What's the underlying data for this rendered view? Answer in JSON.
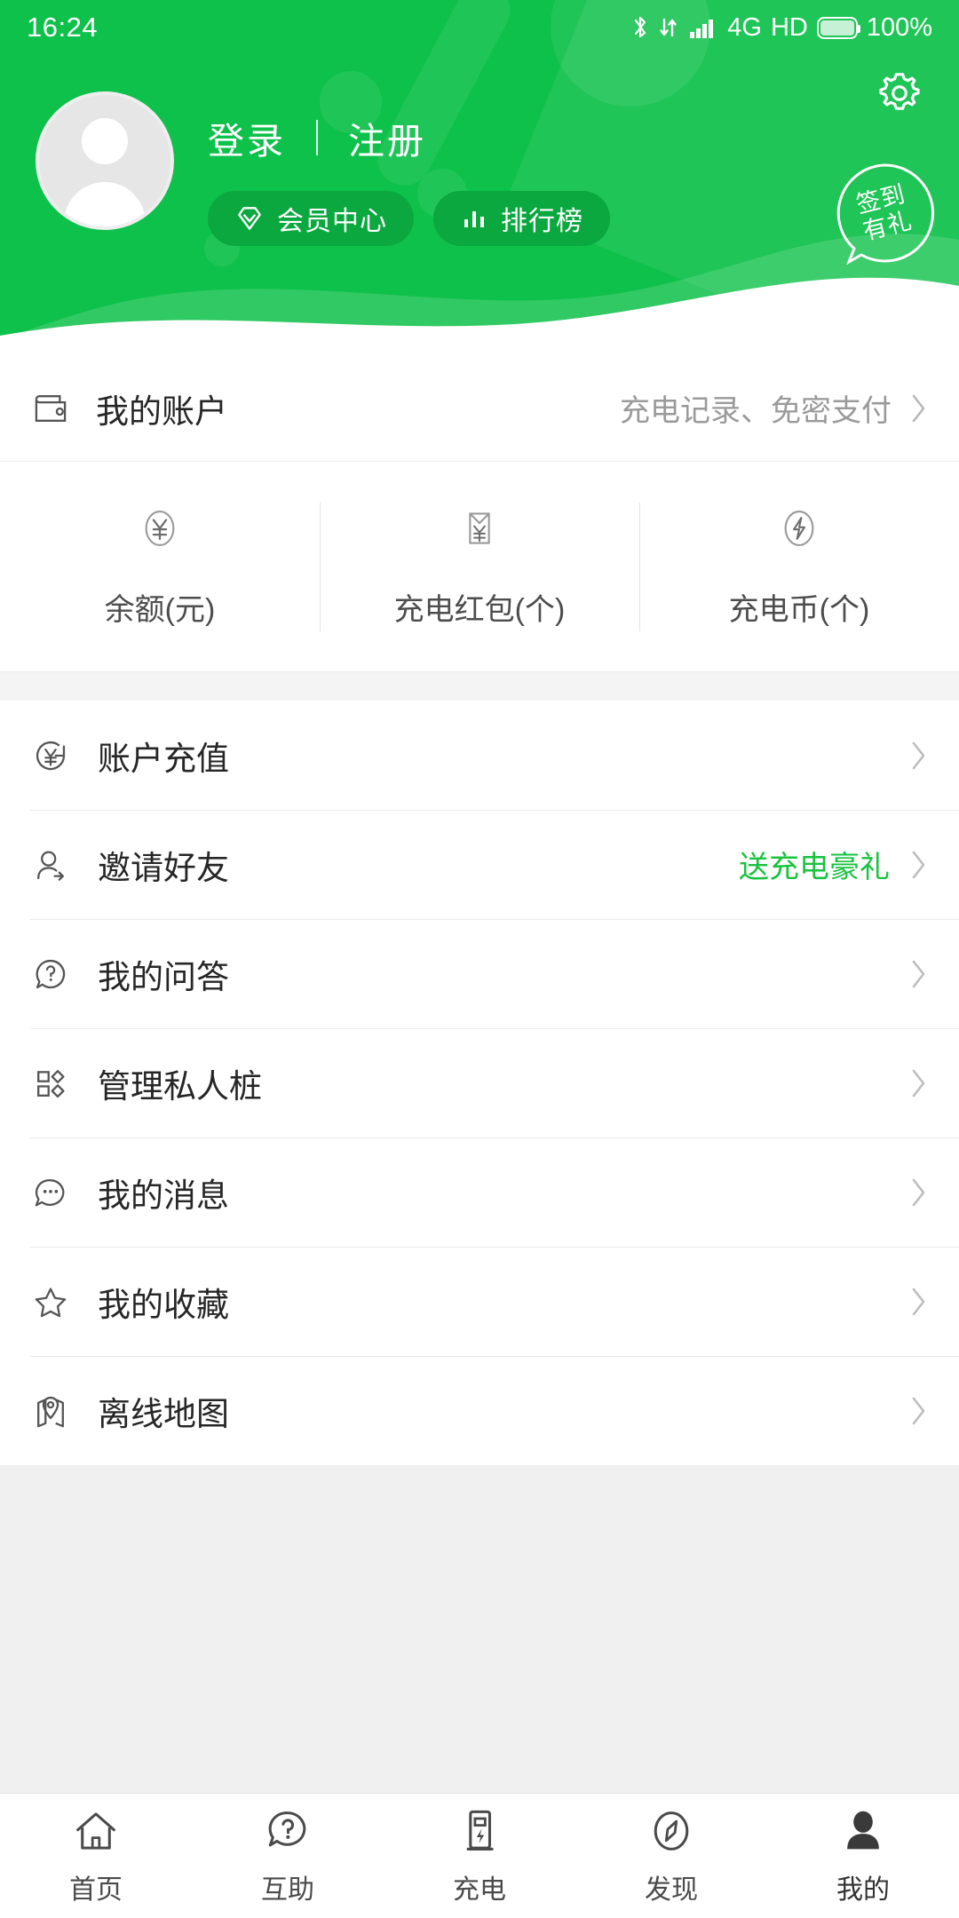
{
  "theme": {
    "brand_green": "#0ec14a",
    "pill_green": "#0aa83f",
    "accent_text_green": "#19c23f",
    "page_bg": "#f0f0f0"
  },
  "status_bar": {
    "time": "16:24",
    "bluetooth_icon": "bluetooth-icon",
    "data_icon": "data-transfer-icon",
    "signal_icon": "signal-bars-icon",
    "network": "4G",
    "volte": "HD",
    "battery_icon": "battery-icon",
    "battery_percent": "100%"
  },
  "header": {
    "settings_icon": "gear-icon",
    "avatar_icon": "avatar-placeholder-icon",
    "login_label": "登录",
    "separator": "|",
    "register_label": "注册",
    "pills": [
      {
        "label": "会员中心",
        "icon": "diamond-icon"
      },
      {
        "label": "排行榜",
        "icon": "bar-chart-icon"
      }
    ],
    "signin_badge": {
      "line1": "签到",
      "line2": "有礼",
      "icon": "speech-bubble-circle-icon"
    }
  },
  "account_row": {
    "icon": "wallet-icon",
    "label": "我的账户",
    "hint": "充电记录、免密支付",
    "chevron_icon": "chevron-right-icon"
  },
  "stats": [
    {
      "icon": "yuan-circle-icon",
      "label": "余额(元)"
    },
    {
      "icon": "red-packet-icon",
      "label": "充电红包(个)"
    },
    {
      "icon": "bolt-circle-icon",
      "label": "充电币(个)"
    }
  ],
  "menu": [
    {
      "icon": "recharge-icon",
      "label": "账户充值",
      "note": "",
      "chevron_icon": "chevron-right-icon"
    },
    {
      "icon": "invite-user-icon",
      "label": "邀请好友",
      "note": "送充电豪礼",
      "chevron_icon": "chevron-right-icon"
    },
    {
      "icon": "question-bubble-icon",
      "label": "我的问答",
      "note": "",
      "chevron_icon": "chevron-right-icon"
    },
    {
      "icon": "manage-pile-icon",
      "label": "管理私人桩",
      "note": "",
      "chevron_icon": "chevron-right-icon"
    },
    {
      "icon": "message-bubble-icon",
      "label": "我的消息",
      "note": "",
      "chevron_icon": "chevron-right-icon"
    },
    {
      "icon": "star-icon",
      "label": "我的收藏",
      "note": "",
      "chevron_icon": "chevron-right-icon"
    },
    {
      "icon": "offline-map-icon",
      "label": "离线地图",
      "note": "",
      "chevron_icon": "chevron-right-icon"
    }
  ],
  "bottom_nav": {
    "active_index": 4,
    "items": [
      {
        "label": "首页",
        "icon": "home-icon"
      },
      {
        "label": "互助",
        "icon": "question-bubble-icon"
      },
      {
        "label": "充电",
        "icon": "charging-pile-icon"
      },
      {
        "label": "发现",
        "icon": "compass-icon"
      },
      {
        "label": "我的",
        "icon": "person-icon"
      }
    ]
  }
}
